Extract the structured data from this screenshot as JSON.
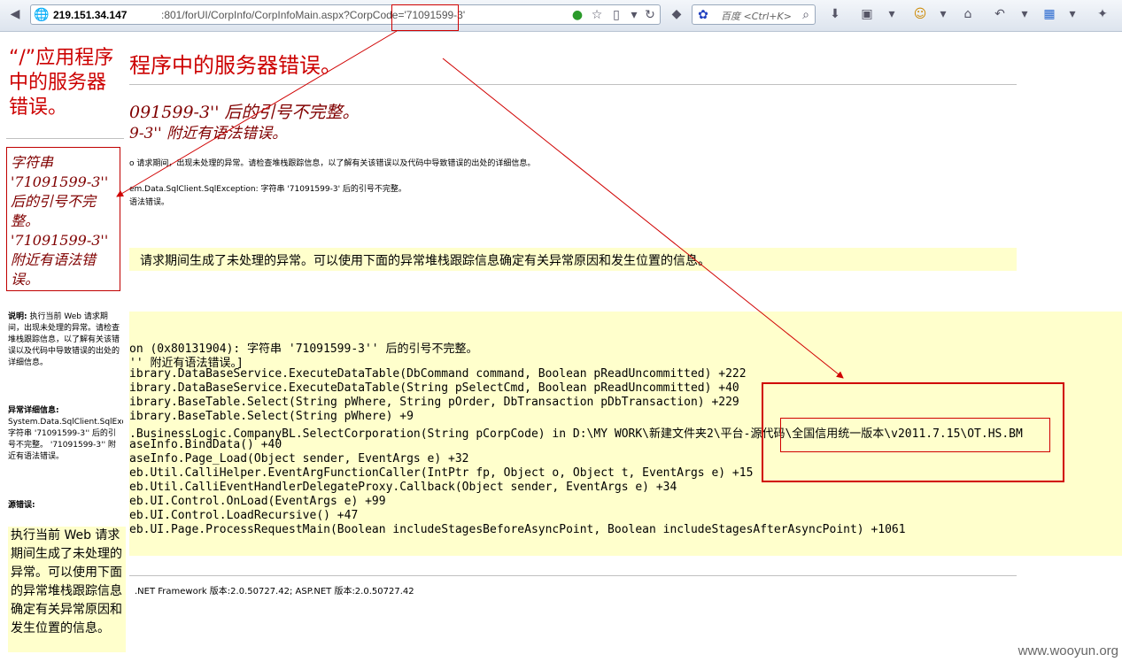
{
  "browser": {
    "url_host": "219.151.34.147",
    "url_path": ":801/forUI/CorpInfo/CorpInfoMain.aspx?CorpCode='71091599-3'",
    "search_placeholder": "百度 <Ctrl+K>"
  },
  "page": {
    "title": "“/”应用程序中的服务器错误。",
    "title_visible": "程序中的服务器错误。",
    "error_line1": "091599-3'' 后的引号不完整。",
    "error_line2": "9-3'' 附近有语法错误。",
    "desc_text": "o 请求期间，出现未处理的异常。请检查堆栈跟踪信息，以了解有关该错误以及代码中导致错误的出处的详细信息。",
    "exc_line1": "em.Data.SqlClient.SqlException: 字符串 '71091599-3' 后的引号不完整。",
    "exc_line2": "语法错误。",
    "source_notice": "请求期间生成了未处理的异常。可以使用下面的异常堆栈跟踪信息确定有关异常原因和发生位置的信息。",
    "stack_lines": [
      "on (0x80131904): 字符串 '71091599-3'' 后的引号不完整。",
      "'' 附近有语法错误。]",
      "ibrary.DataBaseService.ExecuteDataTable(DbCommand command, Boolean pReadUncommitted) +222",
      "ibrary.DataBaseService.ExecuteDataTable(String pSelectCmd, Boolean pReadUncommitted) +40",
      "ibrary.BaseTable.Select(String pWhere, String pOrder, DbTransaction pDbTransaction) +229",
      "ibrary.BaseTable.Select(String pWhere) +9",
      ".BusinessLogic.CompanyBL.SelectCorporation(String pCorpCode) in D:\\MY WORK\\新建文件夹2\\平台-源代码\\全国信用统一版本\\v2011.7.15\\OT.HS.BM",
      "aseInfo.BindData() +40",
      "aseInfo.Page_Load(Object sender, EventArgs e) +32",
      "eb.Util.CalliHelper.EventArgFunctionCaller(IntPtr fp, Object o, Object t, EventArgs e) +15",
      "eb.Util.CalliEventHandlerDelegateProxy.Callback(Object sender, EventArgs e) +34",
      "eb.UI.Control.OnLoad(EventArgs e) +99",
      "eb.UI.Control.LoadRecursive() +47",
      "eb.UI.Page.ProcessRequestMain(Boolean includeStagesBeforeAsyncPoint, Boolean includeStagesAfterAsyncPoint) +1061"
    ],
    "version": ".NET Framework 版本:2.0.50727.42; ASP.NET 版本:2.0.50727.42"
  },
  "left_column": {
    "title": "“/”应用程序中的服务器错误。",
    "error_text": "字符串 '71091599-3'' 后的引号不完整。 '71091599-3'' 附近有语法错误。",
    "desc_label": "说明:",
    "desc_text": "执行当前 Web 请求期间，出现未处理的异常。请检查堆栈跟踪信息，以了解有关该错误以及代码中导致错误的出处的详细信息。",
    "exc_label": "异常详细信息:",
    "exc_type": "System.Data.SqlClient.SqlException:",
    "exc_text": "字符串 '71091599-3'' 后的引号不完整。 '71091599-3'' 附近有语法错误。",
    "src_label": "源错误:",
    "notice": "执行当前 Web 请求期间生成了未处理的异常。可以使用下面的异常堆栈跟踪信息确定有关异常原因和发生位置的信息。"
  },
  "watermark": "www.wooyun.org",
  "colors": {
    "accent_red": "#c00000",
    "error_maroon": "#800000",
    "notice_yellow": "#ffffcc"
  }
}
